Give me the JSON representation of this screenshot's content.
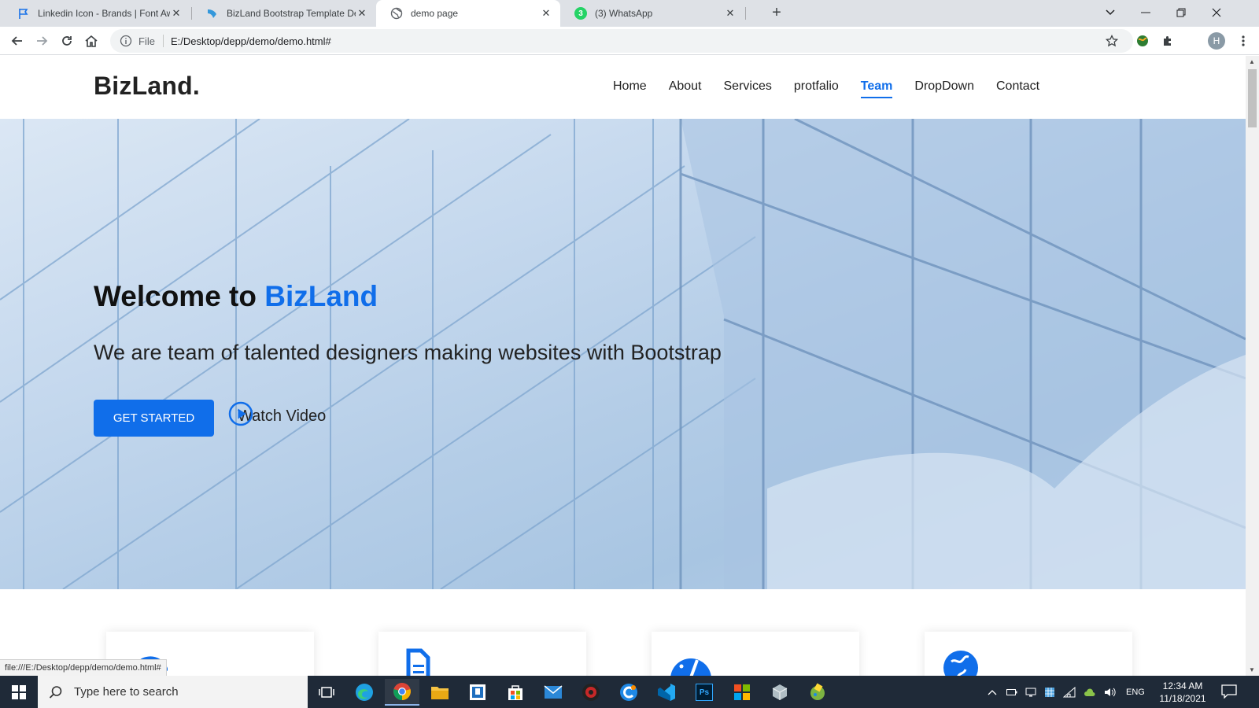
{
  "browser": {
    "tabs": [
      {
        "title": "Linkedin Icon - Brands | Font Awe",
        "active": false
      },
      {
        "title": "BizLand Bootstrap Template Dem",
        "active": false
      },
      {
        "title": "demo page",
        "active": true
      },
      {
        "title": "(3) WhatsApp",
        "active": false
      }
    ],
    "whatsapp_badge": "3",
    "address": {
      "scheme_label": "File",
      "url": "E:/Desktop/depp/demo/demo.html#"
    },
    "profile_initial": "H",
    "status_url": "file:///E:/Desktop/depp/demo/demo.html#"
  },
  "site": {
    "logo": "BizLand.",
    "nav": [
      {
        "label": "Home",
        "active": false
      },
      {
        "label": "About",
        "active": false
      },
      {
        "label": "Services",
        "active": false
      },
      {
        "label": "protfalio",
        "active": false
      },
      {
        "label": "Team",
        "active": true
      },
      {
        "label": "DropDown",
        "active": false
      },
      {
        "label": "Contact",
        "active": false
      }
    ],
    "hero": {
      "title_prefix": "Welcome to ",
      "title_brand": "BizLand",
      "subtitle": "We are team of talented designers making websites with Bootstrap",
      "cta_label": "GET STARTED",
      "video_label": "Watch Video"
    },
    "cards": [
      {
        "icon": "dribbble-icon"
      },
      {
        "icon": "file-icon"
      },
      {
        "icon": "speedometer-icon"
      },
      {
        "icon": "globe-icon"
      }
    ],
    "accent_color": "#106eea"
  },
  "taskbar": {
    "search_placeholder": "Type here to search",
    "apps": [
      "task-view-icon",
      "edge-icon",
      "chrome-icon",
      "file-explorer-icon",
      "terminal-icon",
      "store-icon",
      "mail-icon",
      "app-red-icon",
      "app-blue-icon",
      "vscode-icon",
      "photoshop-icon",
      "office-icon",
      "box-icon",
      "paint-icon"
    ],
    "language": "ENG",
    "time": "12:34 AM",
    "date": "11/18/2021"
  }
}
